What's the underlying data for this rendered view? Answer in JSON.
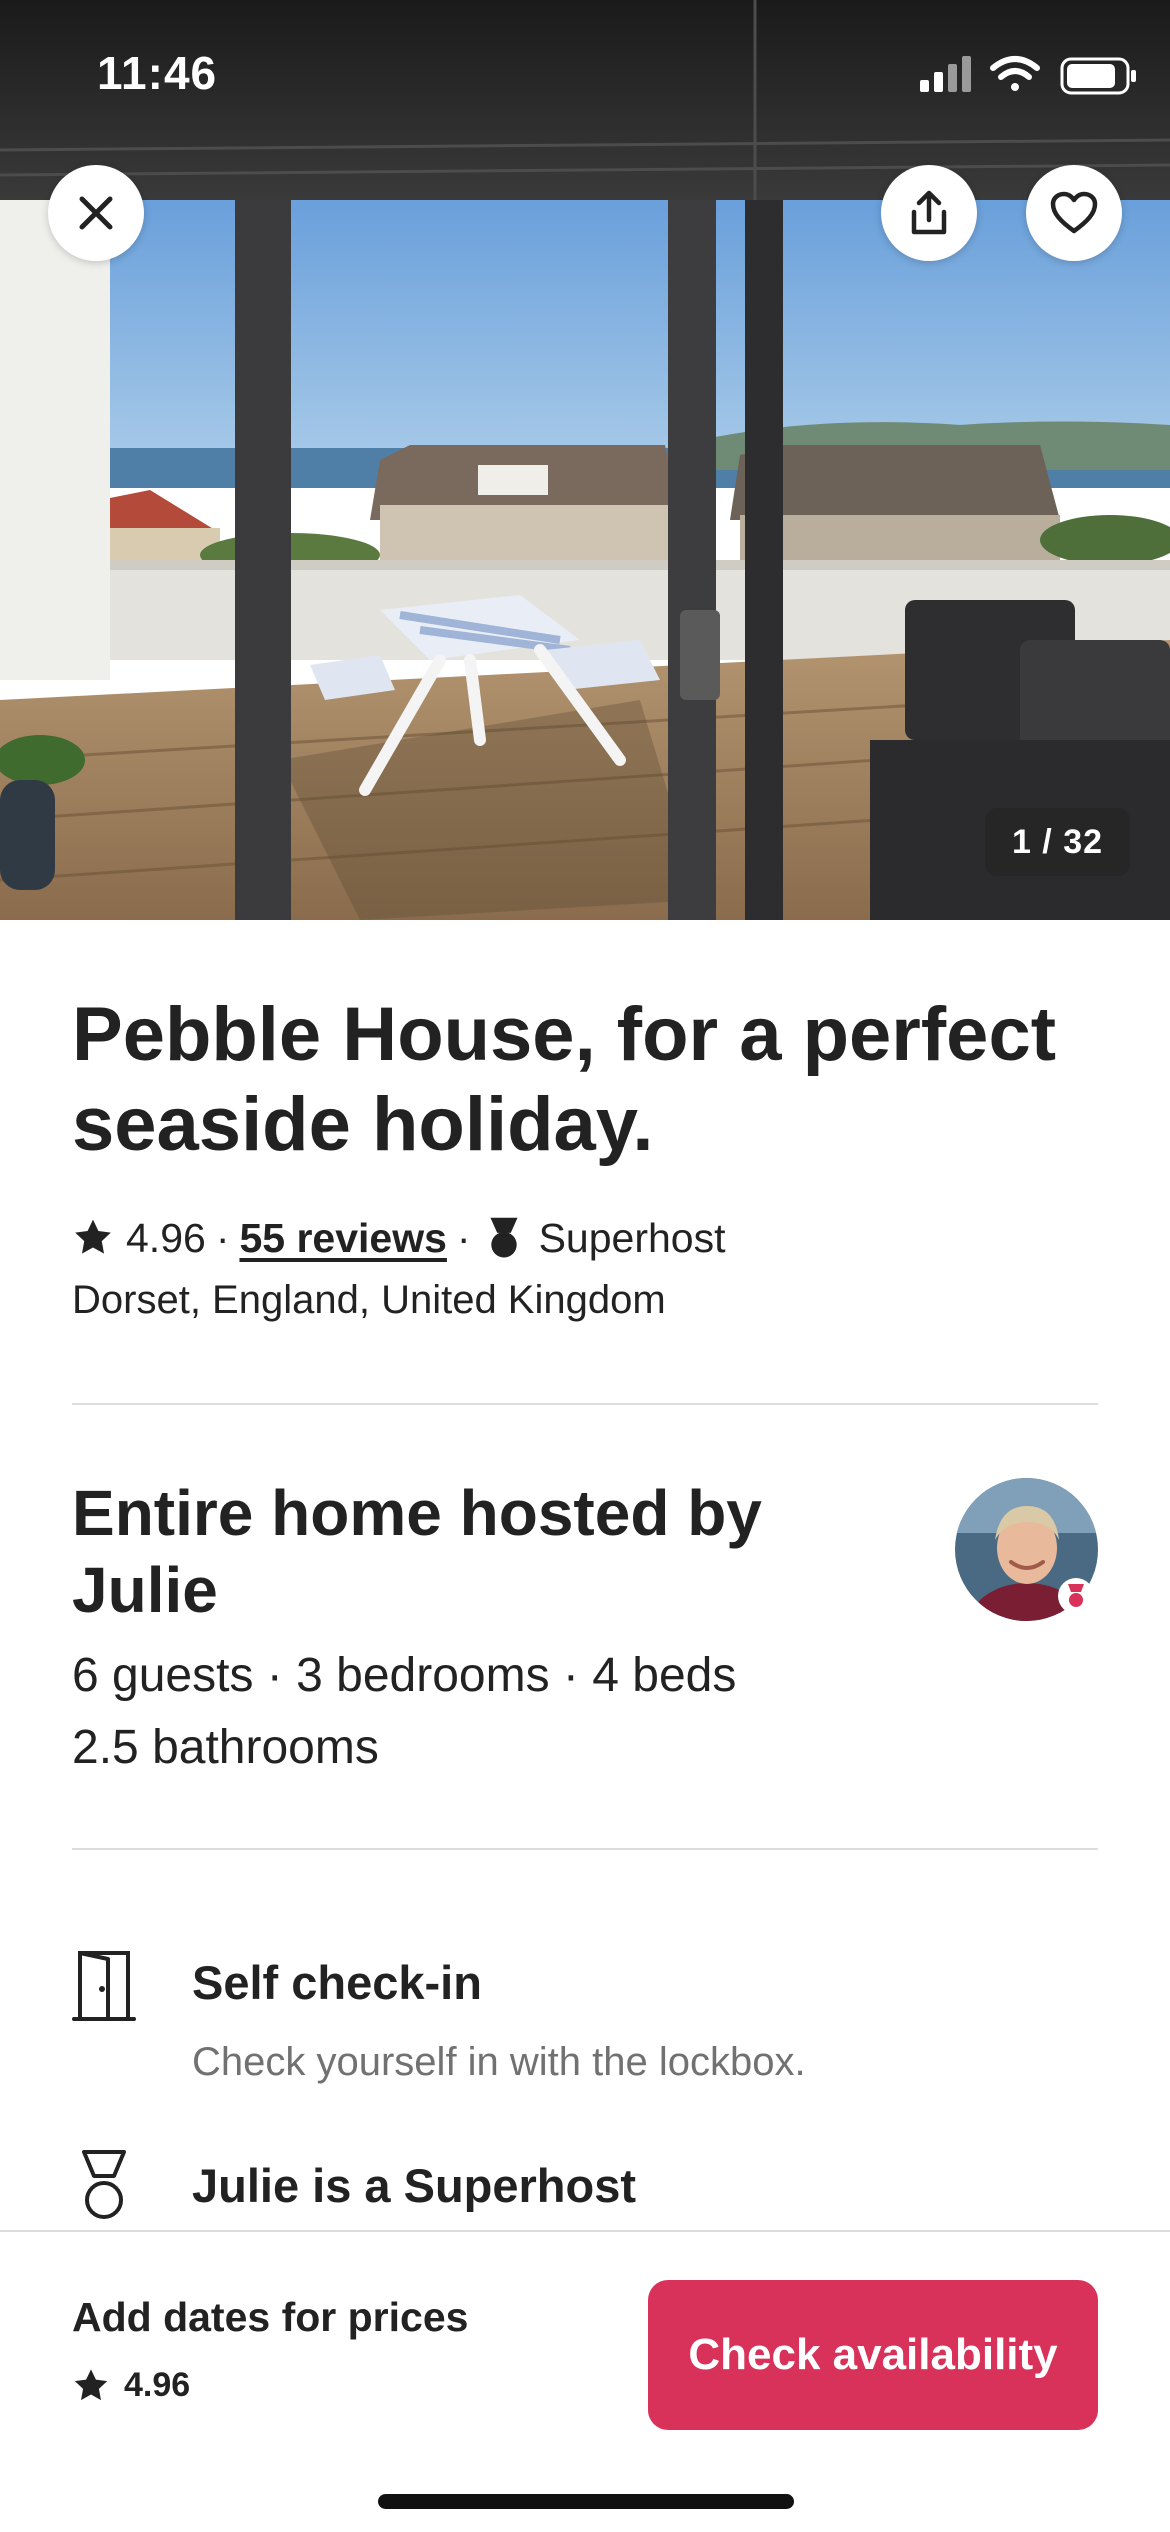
{
  "status_bar": {
    "time": "11:46"
  },
  "hero": {
    "photo_counter": "1 / 32",
    "close_icon": "close-icon",
    "share_icon": "share-icon",
    "save_icon": "heart-icon"
  },
  "listing": {
    "title": "Pebble House, for a perfect seaside holiday.",
    "rating": "4.96",
    "separator": "·",
    "reviews_link": "55 reviews",
    "superhost_badge": "Superhost",
    "location": "Dorset, England, United Kingdom"
  },
  "host_section": {
    "heading": "Entire home hosted by Julie",
    "capacity_line": "6 guests · 3 bedrooms · 4 beds",
    "bathrooms_line": "2.5 bathrooms"
  },
  "features": [
    {
      "icon": "door-icon",
      "title": "Self check-in",
      "subtitle": "Check yourself in with the lockbox."
    },
    {
      "icon": "medal-icon",
      "title": "Julie is a Superhost",
      "subtitle": ""
    }
  ],
  "footer": {
    "prices_label": "Add dates for prices",
    "rating": "4.96",
    "cta_label": "Check availability"
  },
  "colors": {
    "brand": "#d8325a",
    "text_primary": "#222222",
    "text_secondary": "#717171",
    "divider": "#dddddd"
  }
}
